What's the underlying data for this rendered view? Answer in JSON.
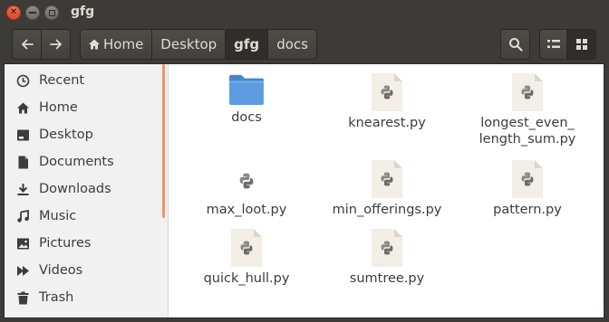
{
  "window": {
    "title": "gfg"
  },
  "toolbar": {
    "breadcrumbs": [
      "Home",
      "Desktop",
      "gfg",
      "docs"
    ]
  },
  "sidebar": {
    "items": [
      {
        "label": "Recent",
        "icon": "clock-icon"
      },
      {
        "label": "Home",
        "icon": "home-icon"
      },
      {
        "label": "Desktop",
        "icon": "desktop-icon"
      },
      {
        "label": "Documents",
        "icon": "document-icon"
      },
      {
        "label": "Downloads",
        "icon": "download-icon"
      },
      {
        "label": "Music",
        "icon": "music-icon"
      },
      {
        "label": "Pictures",
        "icon": "picture-icon"
      },
      {
        "label": "Videos",
        "icon": "video-icon"
      },
      {
        "label": "Trash",
        "icon": "trash-icon"
      }
    ]
  },
  "files": [
    {
      "name": "docs",
      "type": "folder"
    },
    {
      "name": "knearest.py",
      "type": "python"
    },
    {
      "name": "longest_even_\nlength_sum.py",
      "type": "python"
    },
    {
      "name": "max_loot.py",
      "type": "python-small"
    },
    {
      "name": "min_offerings.py",
      "type": "python"
    },
    {
      "name": "pattern.py",
      "type": "python"
    },
    {
      "name": "quick_hull.py",
      "type": "python"
    },
    {
      "name": "sumtree.py",
      "type": "python"
    }
  ],
  "colors": {
    "accent": "#f29364",
    "folder": "#5a93d8"
  }
}
